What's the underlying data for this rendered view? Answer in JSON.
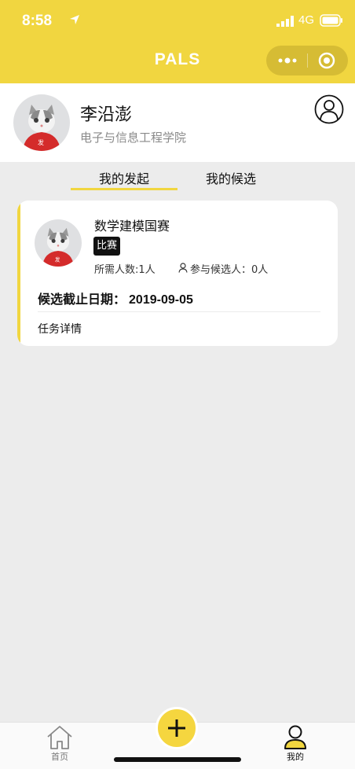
{
  "status_bar": {
    "time": "8:58",
    "network": "4G",
    "icons": [
      "location-arrow-icon",
      "signal-icon",
      "battery-icon"
    ]
  },
  "nav": {
    "title": "PALS",
    "capsule_icons": [
      "more-icon",
      "target-icon"
    ]
  },
  "profile": {
    "name": "李沿澎",
    "college": "电子与信息工程学院"
  },
  "tabs": [
    {
      "label": "我的发起",
      "active": true
    },
    {
      "label": "我的候选",
      "active": false
    }
  ],
  "task_card": {
    "title": "数学建模国赛",
    "tag": "比赛",
    "need_text": "所需人数:1人",
    "candidates_text": "参与候选人：0人",
    "deadline_label": "候选截止日期：",
    "deadline_date": "2019-09-05",
    "detail_label": "任务详情"
  },
  "bottom_nav": {
    "home_label": "首页",
    "mine_label": "我的"
  },
  "colors": {
    "brand_yellow": "#f1d640",
    "background": "#ececec"
  }
}
